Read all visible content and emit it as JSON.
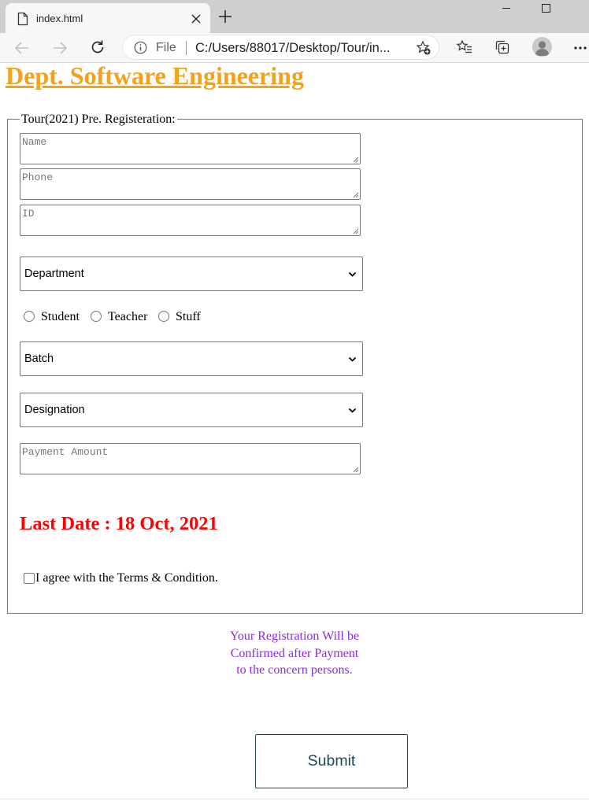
{
  "browser": {
    "tab_title": "index.html",
    "address_scheme": "File",
    "address_url": "C:/Users/88017/Desktop/Tour/in..."
  },
  "page": {
    "heading": "Dept. Software Engineering",
    "legend": "Tour(2021) Pre. Registeration:",
    "name_placeholder": "Name",
    "phone_placeholder": "Phone",
    "id_placeholder": "ID",
    "department_select": "Department",
    "roles": [
      {
        "label": "Student",
        "selected": false
      },
      {
        "label": "Teacher",
        "selected": false
      },
      {
        "label": "Stuff",
        "selected": false
      }
    ],
    "batch_select": "Batch",
    "designation_select": "Designation",
    "payment_placeholder": "Payment Amount",
    "last_date": "Last Date : 18 Oct, 2021",
    "terms_label": "I agree with the Terms & Condition.",
    "terms_checked": false,
    "note_lines": [
      "Your Registration Will be",
      "Confirmed after Payment",
      "to the concern persons."
    ],
    "submit_label": "Submit"
  },
  "colors": {
    "heading": "#f5a21b",
    "last_date": "#ff0000",
    "note": "#8a2be2",
    "submit_text": "#1e4b57"
  }
}
